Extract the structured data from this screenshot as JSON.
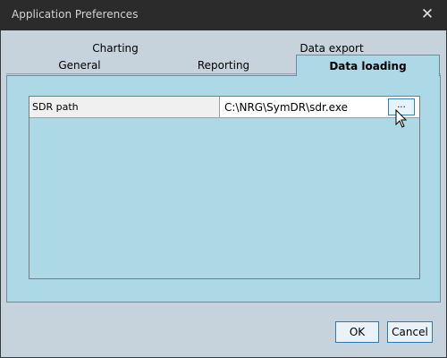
{
  "window": {
    "title": "Application Preferences"
  },
  "tabs": {
    "back_row": [
      "Charting",
      "Data export"
    ],
    "front_row": [
      "General",
      "Reporting"
    ],
    "active": "Data loading"
  },
  "settings": [
    {
      "label": "SDR path",
      "value": "C:\\NRG\\SymDR\\sdr.exe",
      "browse_label": "..."
    }
  ],
  "buttons": {
    "ok": "OK",
    "cancel": "Cancel"
  },
  "colors": {
    "tab_page": "#add8e6",
    "titlebar": "#2b2b2b",
    "dialog_bg": "#c7d3dc",
    "button_border": "#2f7ab5"
  }
}
